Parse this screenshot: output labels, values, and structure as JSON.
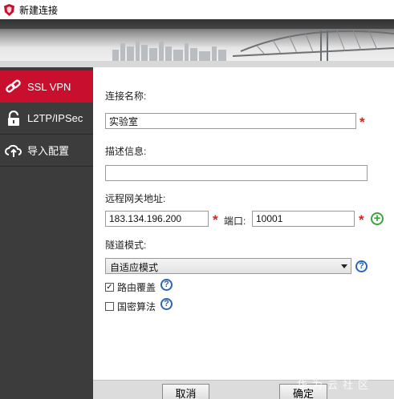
{
  "window": {
    "title": "新建连接"
  },
  "sidebar": {
    "items": [
      {
        "label": "SSL VPN",
        "icon": "link-icon",
        "active": true
      },
      {
        "label": "L2TP/IPSec",
        "icon": "lock-icon",
        "active": false
      },
      {
        "label": "导入配置",
        "icon": "cloud-upload-icon",
        "active": false
      }
    ]
  },
  "form": {
    "name": {
      "label": "连接名称:",
      "value": "实验室"
    },
    "description": {
      "label": "描述信息:",
      "value": ""
    },
    "gateway": {
      "label": "远程网关地址:",
      "value": "183.134.196.200"
    },
    "port": {
      "label": "端口:",
      "value": "10001"
    },
    "tunnel": {
      "label": "隧道模式:",
      "selected": "自适应模式"
    },
    "route_override": {
      "label": "路由覆盖",
      "checked": true
    },
    "national_crypto": {
      "label": "国密算法",
      "checked": false
    },
    "required_mark": "*",
    "help_mark": "?",
    "add_mark": "+"
  },
  "buttons": {
    "cancel": "取消",
    "ok": "确定"
  },
  "watermark": "华为云社区",
  "colors": {
    "accent": "#c8102e",
    "sidebar": "#3c3c3c",
    "required": "#e02020",
    "help": "#2f64b0",
    "add": "#3da33d"
  }
}
